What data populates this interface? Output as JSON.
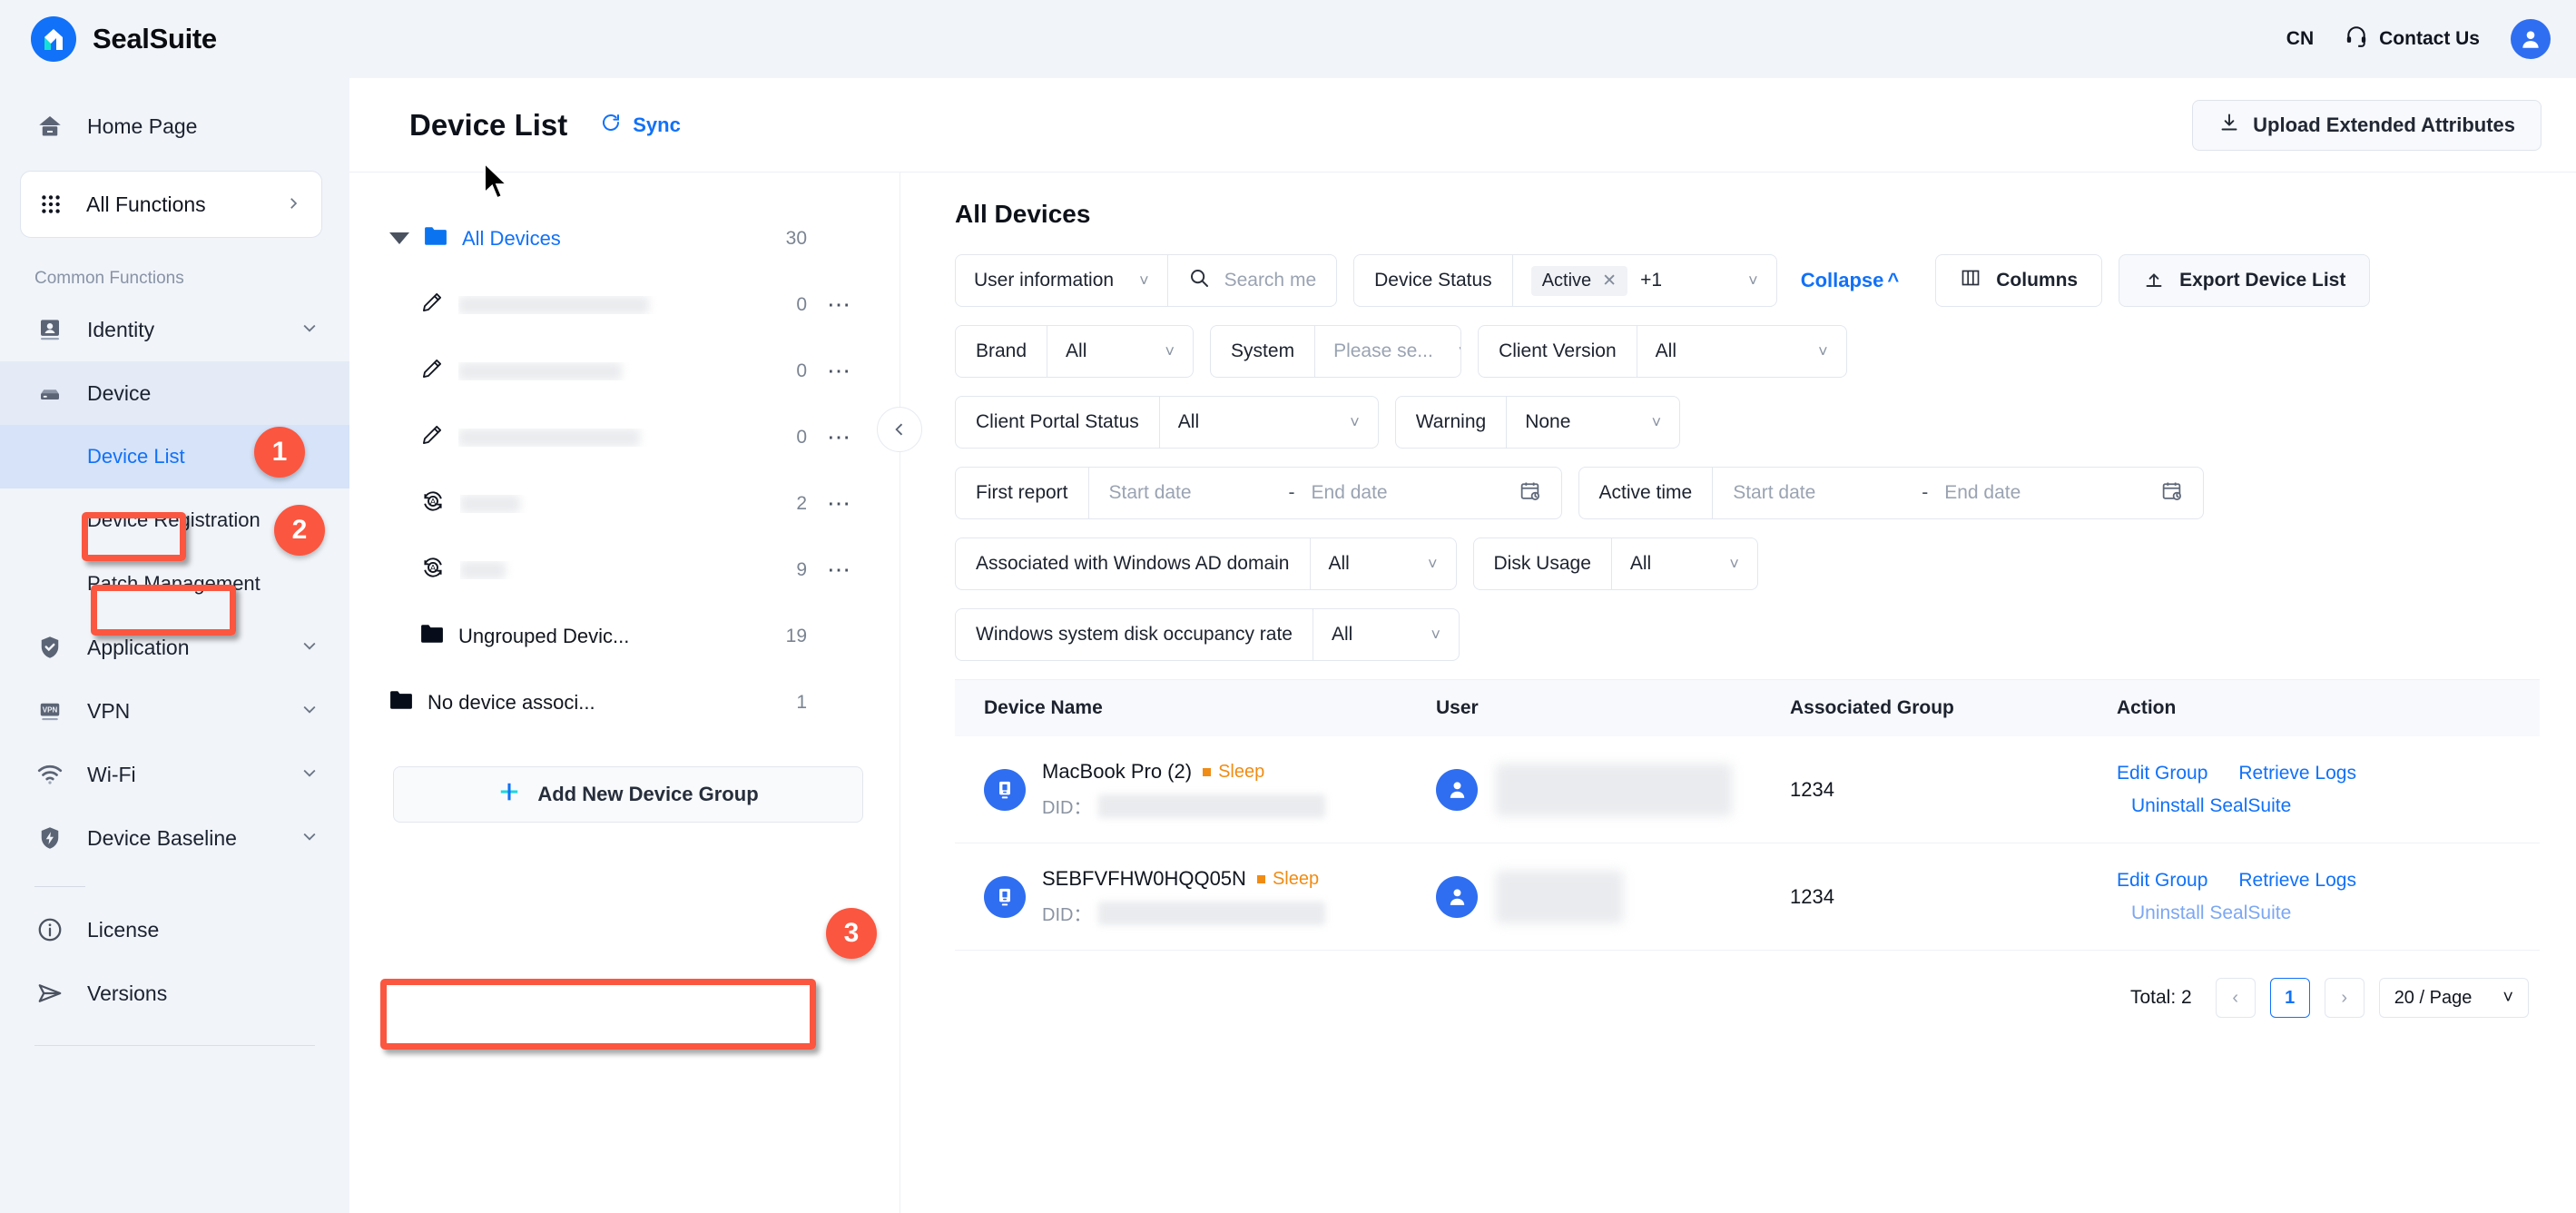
{
  "topbar": {
    "brand_name": "SealSuite",
    "logo_icon": "sealsuite-logo-icon",
    "lang": "CN",
    "contact_label": "Contact Us",
    "headset_icon": "headset-icon",
    "avatar_icon": "user-avatar-icon"
  },
  "sidebar": {
    "home_label": "Home Page",
    "home_icon": "home-icon",
    "all_functions_label": "All Functions",
    "grid_icon": "grid-icon",
    "chevron_right_icon": "chevron-right-icon",
    "section_label": "Common Functions",
    "items": [
      {
        "label": "Identity",
        "icon": "identity-card-icon",
        "chevron": "chevron-down-icon"
      },
      {
        "label": "Device",
        "icon": "device-server-icon",
        "chevron": "chevron-down-icon"
      },
      {
        "label": "Application",
        "icon": "shield-check-icon",
        "chevron": "chevron-down-icon"
      },
      {
        "label": "VPN",
        "icon": "vpn-icon",
        "chevron": "chevron-down-icon"
      },
      {
        "label": "Wi-Fi",
        "icon": "wifi-icon",
        "chevron": "chevron-down-icon"
      },
      {
        "label": "Device Baseline",
        "icon": "shield-bolt-icon",
        "chevron": "chevron-down-icon"
      },
      {
        "label": "License",
        "icon": "info-circle-icon"
      },
      {
        "label": "Versions",
        "icon": "send-icon"
      }
    ],
    "device_children": [
      {
        "label": "Device List"
      },
      {
        "label": "Device Registration"
      },
      {
        "label": "Patch Management"
      }
    ]
  },
  "annotations": [
    {
      "number": "1"
    },
    {
      "number": "2"
    },
    {
      "number": "3"
    }
  ],
  "page": {
    "title": "Device List",
    "sync_label": "Sync",
    "sync_icon": "refresh-icon",
    "upload_label": "Upload Extended Attributes",
    "upload_icon": "upload-icon"
  },
  "tree": {
    "collapse_icon": "chevron-left-icon",
    "root": {
      "label": "All Devices",
      "count": "30",
      "folder_icon": "folder-blue-icon",
      "caret_icon": "caret-down-icon"
    },
    "children": [
      {
        "label": "",
        "count": "0",
        "icon": "pencil-icon",
        "more_icon": "more-dots-icon",
        "redacted": true
      },
      {
        "label": "",
        "count": "0",
        "icon": "pencil-icon",
        "more_icon": "more-dots-icon",
        "redacted": true
      },
      {
        "label": "",
        "count": "0",
        "icon": "pencil-icon",
        "more_icon": "more-dots-icon",
        "redacted": true
      },
      {
        "label": "",
        "count": "2",
        "icon": "auto-sync-icon",
        "more_icon": "more-dots-icon",
        "redacted": true
      },
      {
        "label": "",
        "count": "9",
        "icon": "auto-sync-icon",
        "more_icon": "more-dots-icon",
        "redacted": true
      },
      {
        "label": "Ungrouped Devic...",
        "count": "19",
        "icon": "folder-dark-icon",
        "redacted": false
      }
    ],
    "no_device_group": {
      "label": "No device associ...",
      "count": "1",
      "icon": "folder-dark-icon"
    },
    "add_group_label": "Add New Device Group",
    "plus_icon": "plus-icon"
  },
  "filters": {
    "pane_title": "All Devices",
    "user_information_label": "User information",
    "search_placeholder": "Search me",
    "search_icon": "search-icon",
    "device_status_label": "Device Status",
    "device_status_tag": "Active",
    "device_status_extra": "+1",
    "collapse_label": "Collapse",
    "collapse_caret_icon": "caret-up-icon",
    "columns_label": "Columns",
    "columns_icon": "columns-icon",
    "export_label": "Export Device List",
    "export_icon": "export-icon",
    "brand_label": "Brand",
    "brand_value": "All",
    "system_label": "System",
    "system_placeholder": "Please se...",
    "client_version_label": "Client Version",
    "client_version_value": "All",
    "client_portal_status_label": "Client Portal Status",
    "client_portal_status_value": "All",
    "warning_label": "Warning",
    "warning_value": "None",
    "first_report_label": "First report",
    "active_time_label": "Active time",
    "start_date_placeholder": "Start date",
    "end_date_placeholder": "End date",
    "date_sep": "-",
    "calendar_icon": "calendar-icon",
    "ad_domain_label": "Associated with Windows AD domain",
    "ad_domain_value": "All",
    "disk_usage_label": "Disk Usage",
    "disk_usage_value": "All",
    "win_disk_label": "Windows system disk occupancy rate",
    "win_disk_value": "All"
  },
  "table": {
    "headers": [
      "Device Name",
      "User",
      "Associated Group",
      "Action"
    ],
    "rows": [
      {
        "device_name": "MacBook Pro (2)",
        "status": "Sleep",
        "did_label": "DID：",
        "associated_group": "1234",
        "actions": [
          "Edit Group",
          "Retrieve Logs",
          "Uninstall SealSuite"
        ],
        "device_icon": "monitor-icon",
        "user_icon": "user-avatar-icon"
      },
      {
        "device_name": "SEBFVFHW0HQQ05N",
        "status": "Sleep",
        "did_label": "DID：",
        "associated_group": "1234",
        "actions": [
          "Edit Group",
          "Retrieve Logs",
          "Uninstall SealSuite"
        ],
        "device_icon": "monitor-icon",
        "user_icon": "user-avatar-icon"
      }
    ]
  },
  "pagination": {
    "total": "Total: 2",
    "prev_icon": "chevron-left-icon",
    "next_icon": "chevron-right-icon",
    "current_page": "1",
    "page_size": "20 / Page",
    "chevron_down_icon": "chevron-down-icon"
  },
  "colors": {
    "accent": "#1171f8",
    "annotation": "#fb5640",
    "sidebar_bg": "#f1f4f9",
    "status_sleep": "#f08c14"
  }
}
